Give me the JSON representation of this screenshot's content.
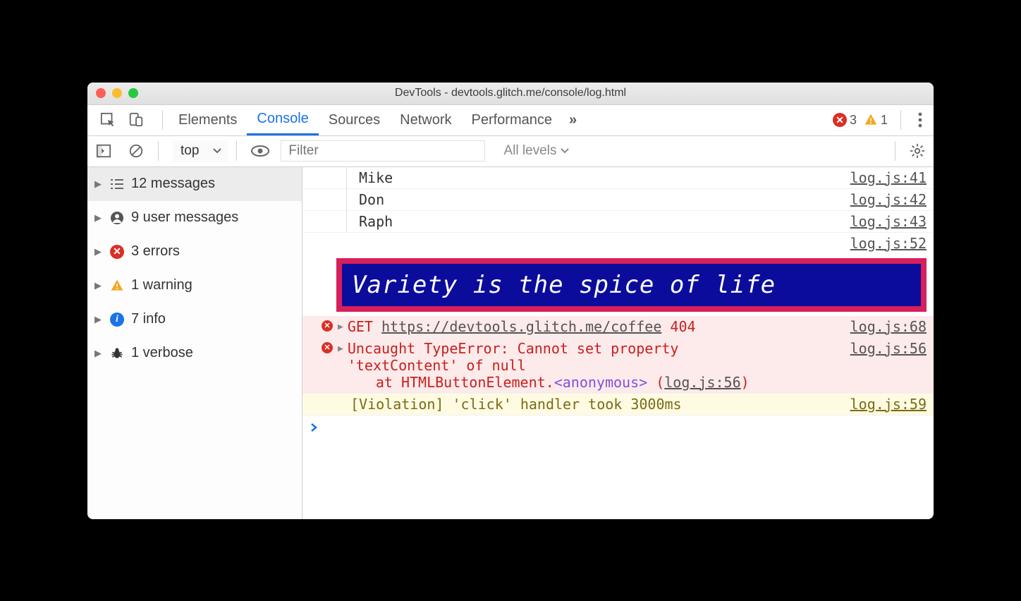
{
  "window": {
    "title": "DevTools - devtools.glitch.me/console/log.html"
  },
  "tabs": {
    "elements": "Elements",
    "console": "Console",
    "sources": "Sources",
    "network": "Network",
    "performance": "Performance"
  },
  "toolbar_badges": {
    "errors": "3",
    "warnings": "1"
  },
  "subbar": {
    "context": "top",
    "filter_placeholder": "Filter",
    "levels": "All levels"
  },
  "sidebar": {
    "messages": "12 messages",
    "user": "9 user messages",
    "errors": "3 errors",
    "warnings": "1 warning",
    "info": "7 info",
    "verbose": "1 verbose"
  },
  "tree": [
    {
      "text": "Mike",
      "src": "log.js:41"
    },
    {
      "text": "Don",
      "src": "log.js:42"
    },
    {
      "text": "Raph",
      "src": "log.js:43"
    }
  ],
  "styled": {
    "text": "Variety is the spice of life",
    "src": "log.js:52"
  },
  "err1": {
    "method": "GET",
    "url": "https://devtools.glitch.me/coffee",
    "code": "404",
    "src": "log.js:68"
  },
  "err2": {
    "line1": "Uncaught TypeError: Cannot set property",
    "line2": "'textContent' of null",
    "stack_prefix": "at HTMLButtonElement.",
    "stack_anon": "<anonymous>",
    "stack_link": "log.js:56",
    "src": "log.js:56"
  },
  "violation": {
    "text": "[Violation] 'click' handler took 3000ms",
    "src": "log.js:59"
  }
}
